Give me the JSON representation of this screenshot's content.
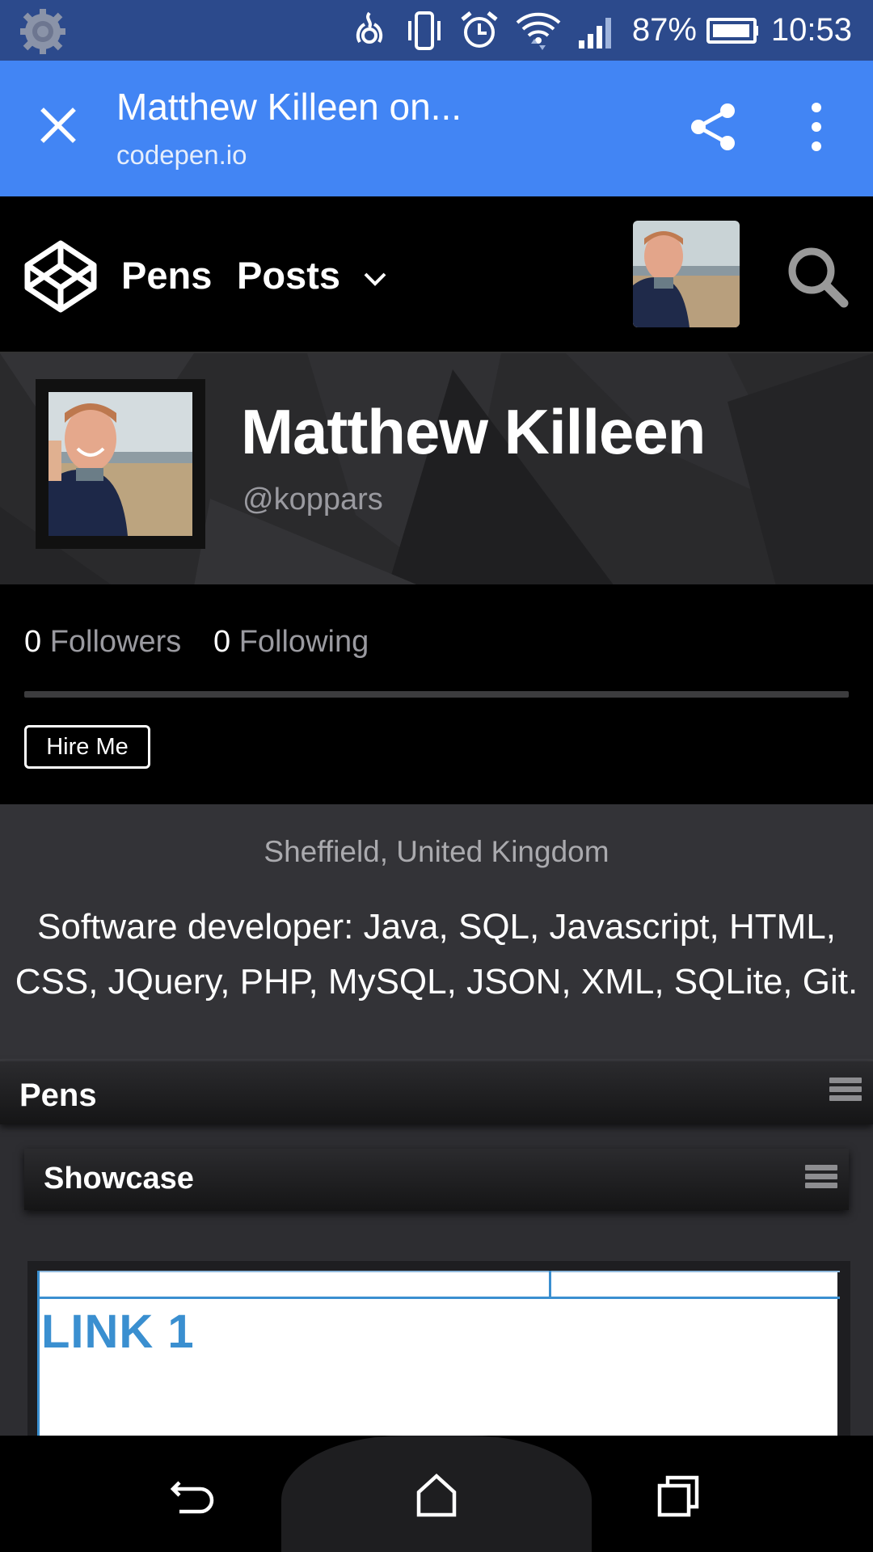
{
  "status_bar": {
    "battery_text": "87%",
    "time": "10:53",
    "icons": [
      "settings-gear-icon",
      "hotspot-icon",
      "vibrate-icon",
      "alarm-icon",
      "wifi-icon",
      "signal-icon",
      "battery-icon"
    ]
  },
  "custom_tab": {
    "title": "Matthew Killeen on...",
    "url": "codepen.io"
  },
  "codepen_nav": {
    "pens_label": "Pens",
    "posts_label": "Posts"
  },
  "profile": {
    "name": "Matthew Killeen",
    "handle": "@koppars",
    "followers_count": "0",
    "followers_label": "Followers",
    "following_count": "0",
    "following_label": "Following",
    "hire_label": "Hire Me",
    "location": "Sheffield, United Kingdom",
    "bio_line1": "Software developer: Java, SQL, Javascript, HTML,",
    "bio_line2": "CSS, JQuery, PHP, MySQL, JSON, XML, SQLite, Git."
  },
  "pens": {
    "section_label": "Pens",
    "collection_label": "Showcase",
    "preview_link": "LINK 1"
  },
  "colors": {
    "status_bar": "#2c4a8c",
    "toolbar": "#4285f4",
    "about_bg": "#333337",
    "link_blue": "#3a8fd0"
  }
}
